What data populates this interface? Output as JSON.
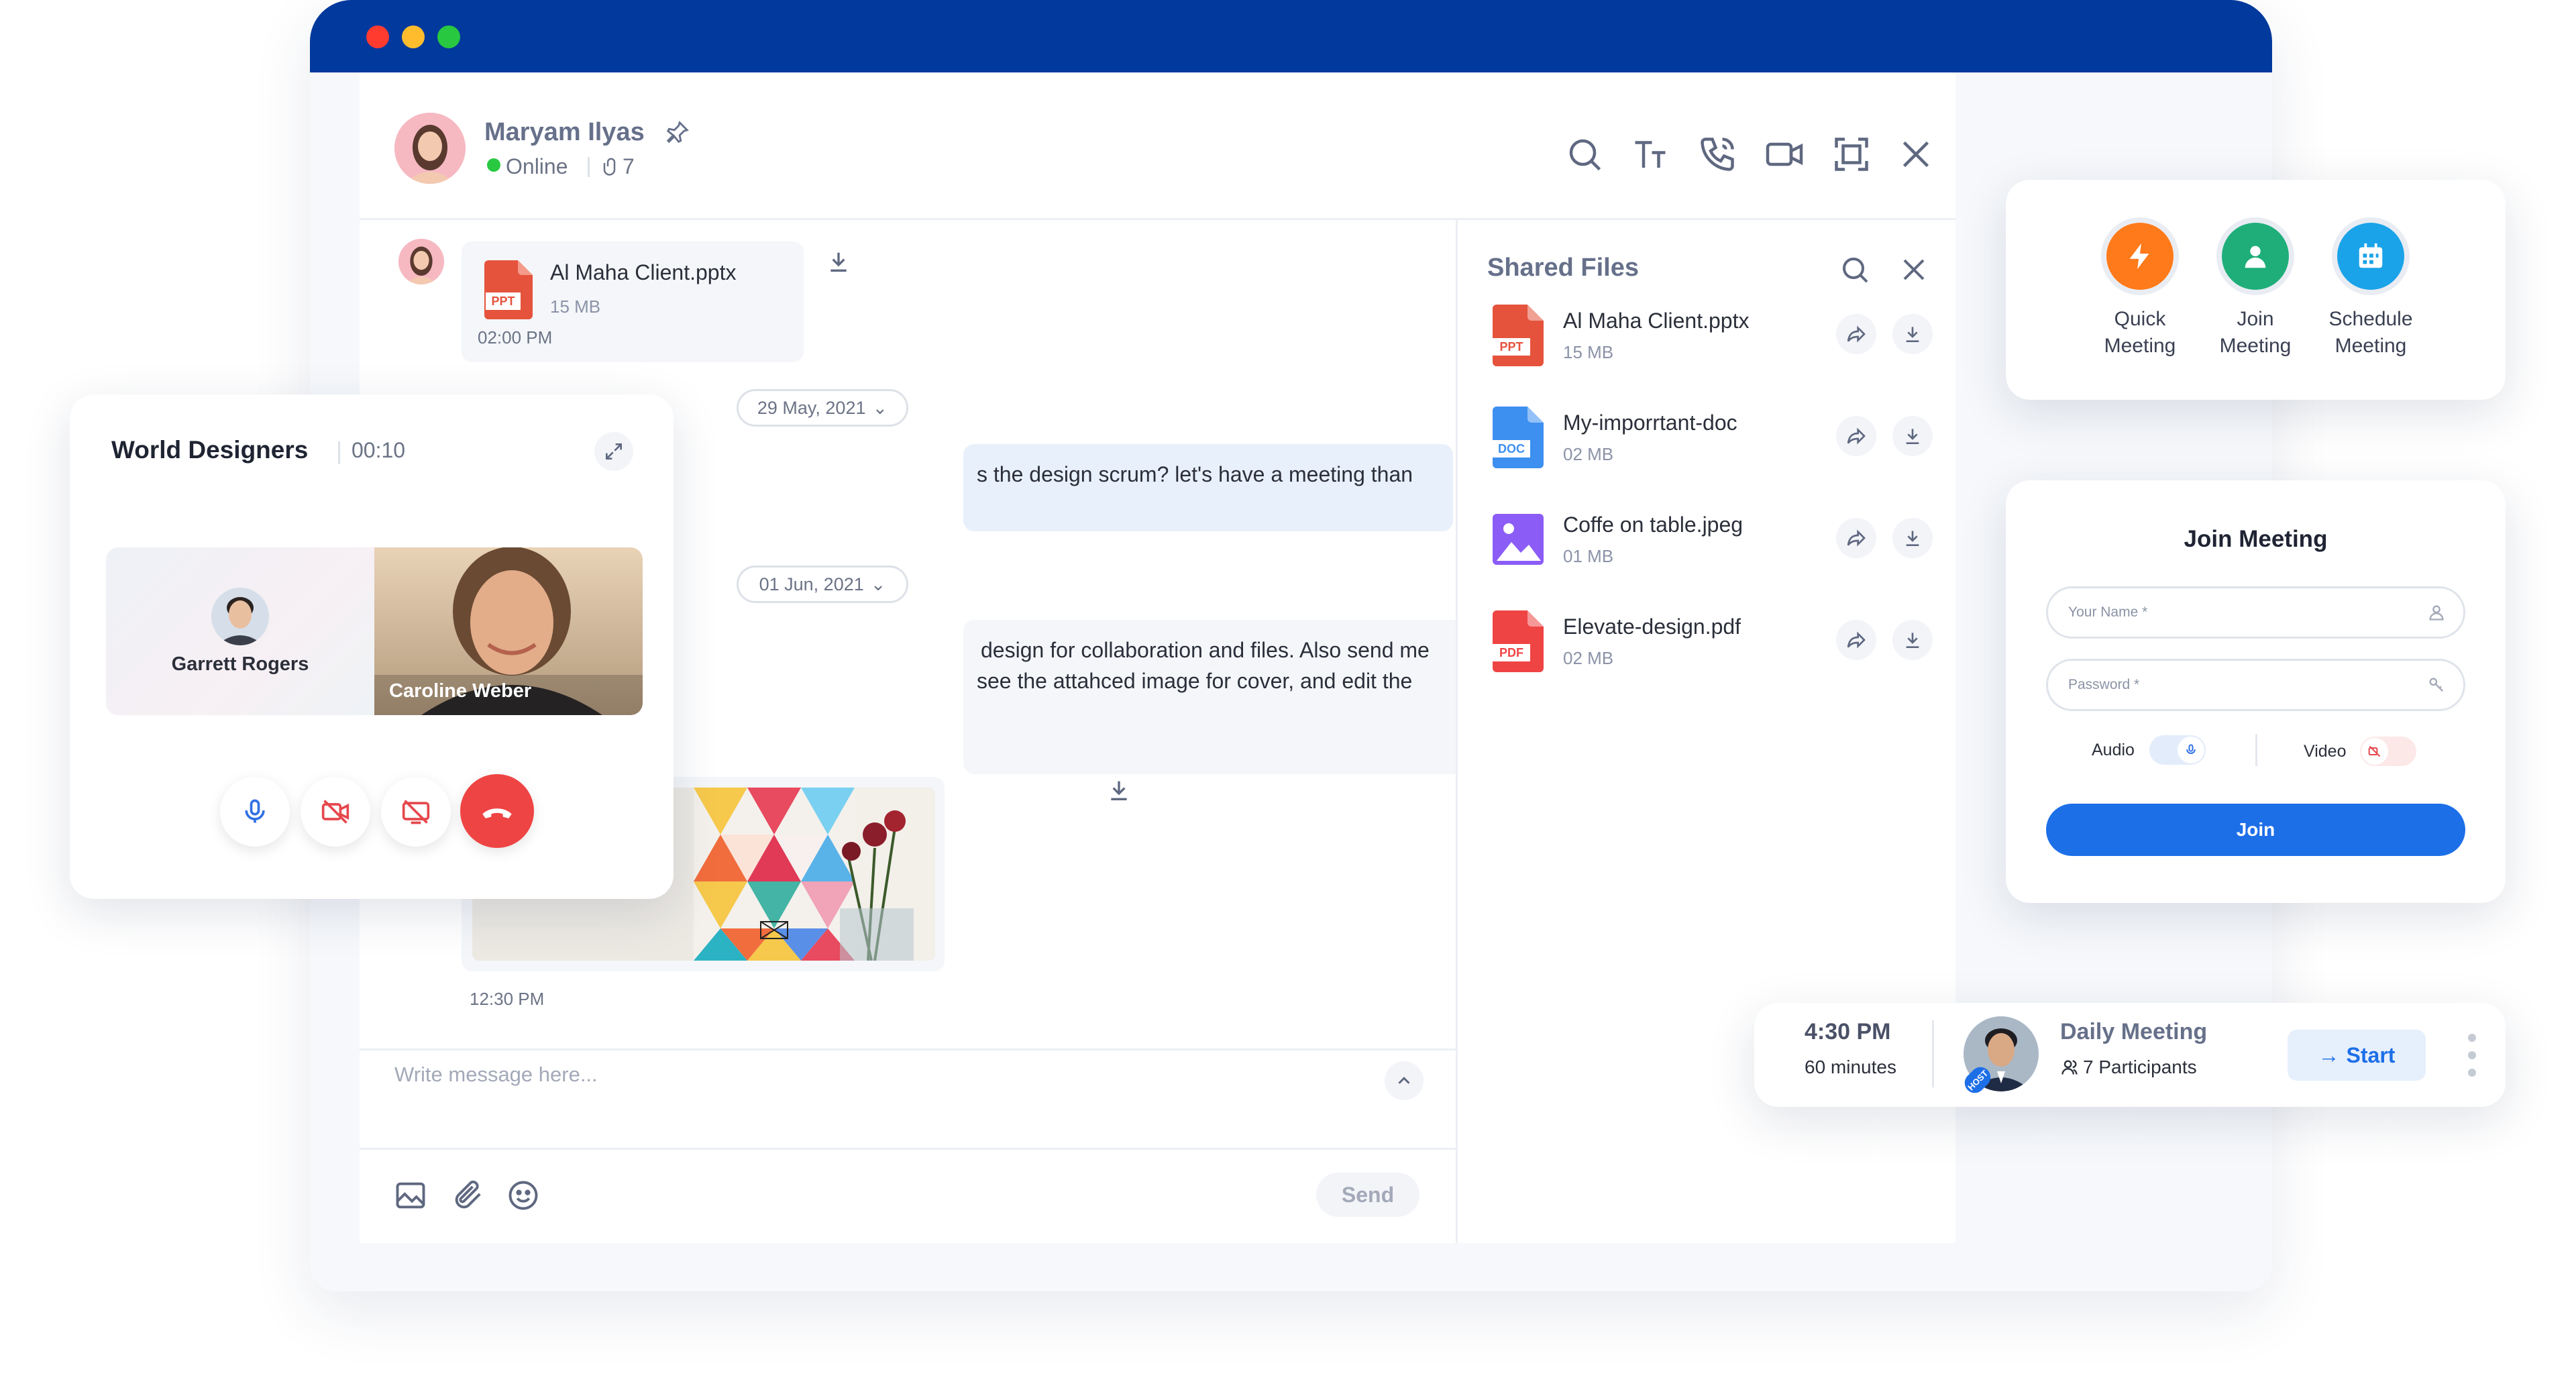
{
  "window": {
    "traffic_lights": [
      "#ff3b30",
      "#ffbd2e",
      "#28c840"
    ],
    "titlebar_color": "#02399c"
  },
  "chat_header": {
    "contact_name": "Maryam Ilyas",
    "status": "Online",
    "attachments_count": "7",
    "icons": [
      "search-icon",
      "text-size-icon",
      "phone-icon",
      "video-icon",
      "fullscreen-icon",
      "close-icon"
    ]
  },
  "messages": {
    "file_message": {
      "file_name": "Al Maha Client.pptx",
      "file_size": "15 MB",
      "time": "02:00 PM",
      "file_type": "PPT"
    },
    "date_1": "29 May, 2021",
    "text_1": "s the design scrum? let's have a meeting than",
    "date_2": "01 Jun, 2021",
    "text_2_line1": "design for collaboration and files. Also send me",
    "text_2_line2": "see the attahced image for cover, and edit the",
    "image_time": "12:30 PM"
  },
  "composer": {
    "placeholder": "Write message here...",
    "send_label": "Send"
  },
  "shared_files": {
    "title": "Shared Files",
    "files": [
      {
        "name": "Al Maha Client.pptx",
        "size": "15 MB",
        "type": "PPT",
        "color": "#e5533d"
      },
      {
        "name": "My-imporrtant-doc",
        "size": "02 MB",
        "type": "DOC",
        "color": "#3d8ff0"
      },
      {
        "name": "Coffe on table.jpeg",
        "size": "01 MB",
        "type": "IMG",
        "color": "#8b5cf6"
      },
      {
        "name": "Elevate-design.pdf",
        "size": "02 MB",
        "type": "PDF",
        "color": "#ef4444"
      }
    ]
  },
  "call": {
    "title": "World Designers",
    "duration": "00:10",
    "participants": [
      "Garrett Rogers",
      "Caroline Weber"
    ]
  },
  "meeting_actions": {
    "items": [
      {
        "label_1": "Quick",
        "label_2": "Meeting",
        "color": "#ff7a1a"
      },
      {
        "label_1": "Join",
        "label_2": "Meeting",
        "color": "#1fae7a"
      },
      {
        "label_1": "Schedule",
        "label_2": "Meeting",
        "color": "#1aa3e8"
      }
    ]
  },
  "join_meeting": {
    "title": "Join Meeting",
    "name_placeholder": "Your Name *",
    "password_placeholder": "Password *",
    "audio_label": "Audio",
    "video_label": "Video",
    "join_label": "Join"
  },
  "daily_meeting": {
    "time": "4:30 PM",
    "duration": "60 minutes",
    "title": "Daily Meeting",
    "participants": "7 Participants",
    "start_label": "Start",
    "host_badge": "HOST"
  }
}
